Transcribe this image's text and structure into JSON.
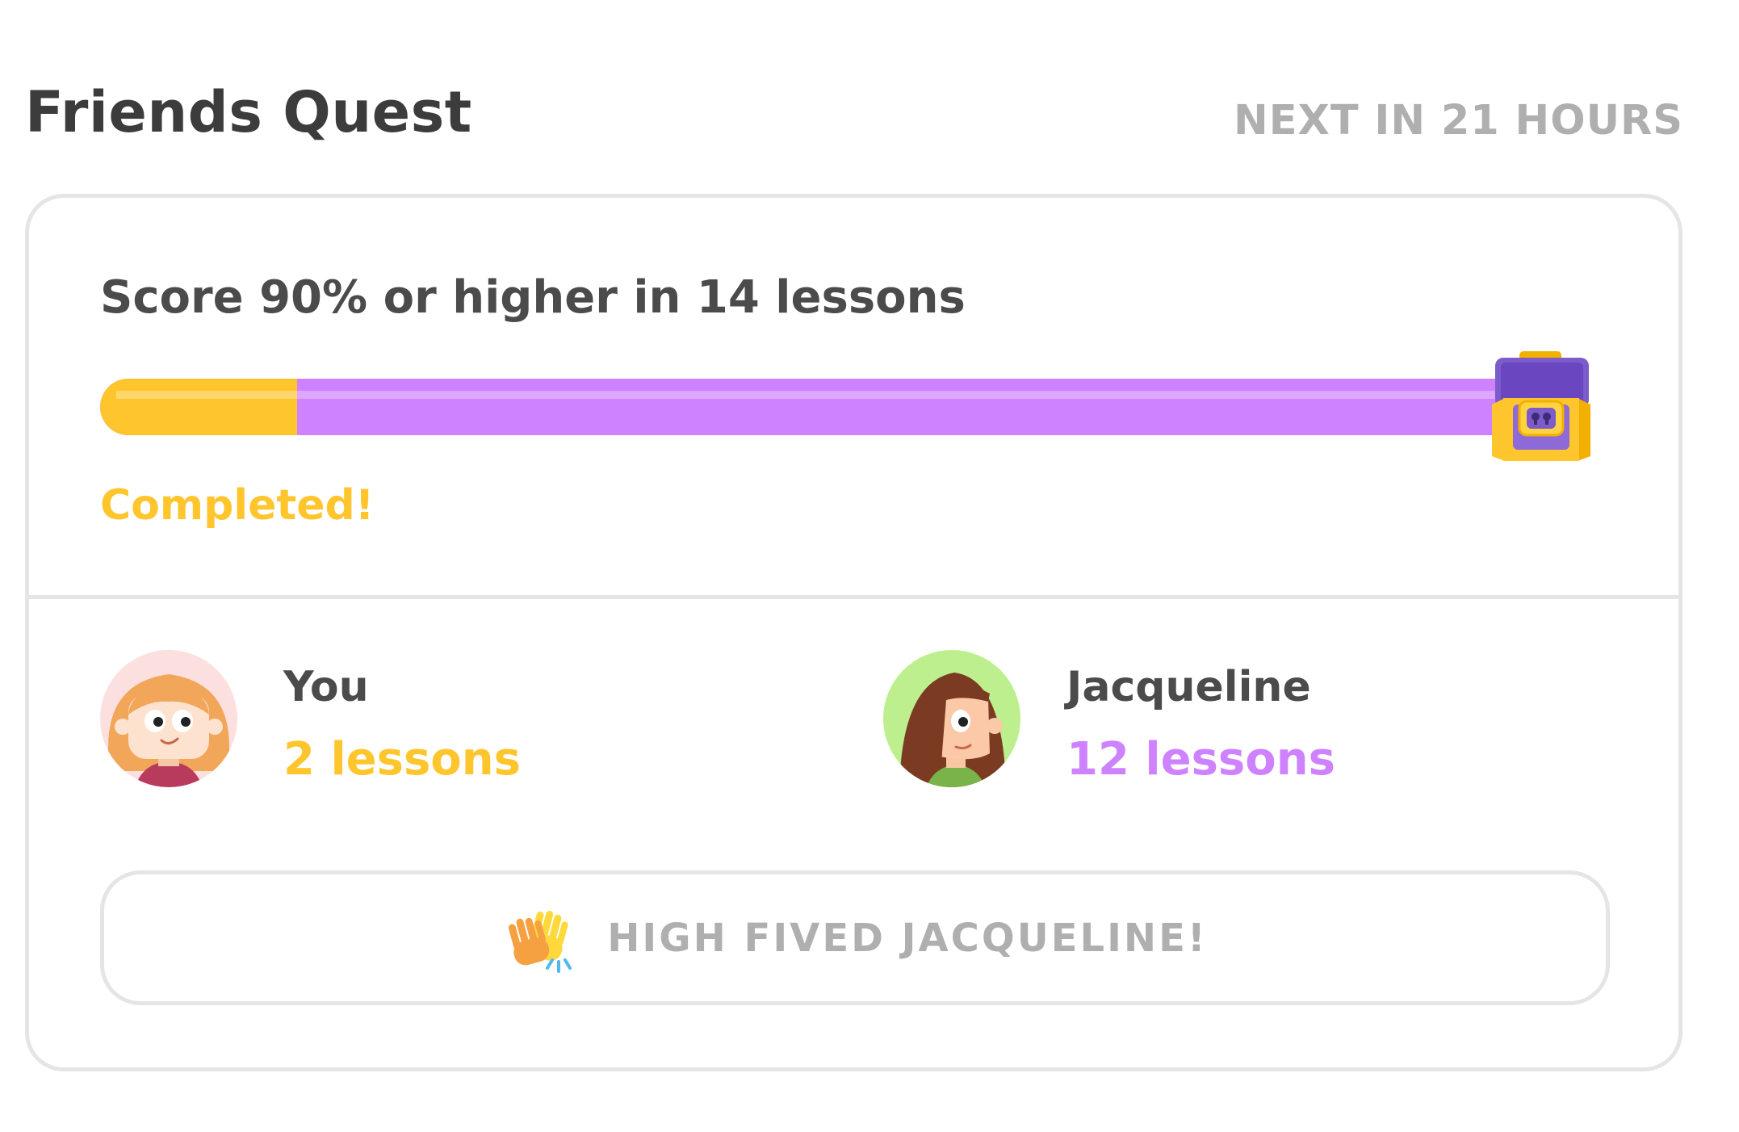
{
  "header": {
    "title": "Friends Quest",
    "next_timer": "NEXT IN 21 HOURS"
  },
  "quest": {
    "title": "Score 90% or higher in 14 lessons",
    "progress_fraction_you": 0.14,
    "status": "Completed!"
  },
  "colors": {
    "you_accent": "#ffc52d",
    "friend_accent": "#ce82ff",
    "border": "#e5e5e5",
    "muted_text": "#afafaf"
  },
  "members": [
    {
      "name": "You",
      "count_label": "2 lessons",
      "lessons": 2,
      "avatar": "girl-blonde-avatar"
    },
    {
      "name": "Jacqueline",
      "count_label": "12 lessons",
      "lessons": 12,
      "avatar": "girl-brown-hair-avatar"
    }
  ],
  "high_five": {
    "label": "HIGH FIVED JACQUELINE!",
    "icon": "high-five-icon"
  },
  "reward": {
    "icon": "treasure-chest-icon"
  }
}
